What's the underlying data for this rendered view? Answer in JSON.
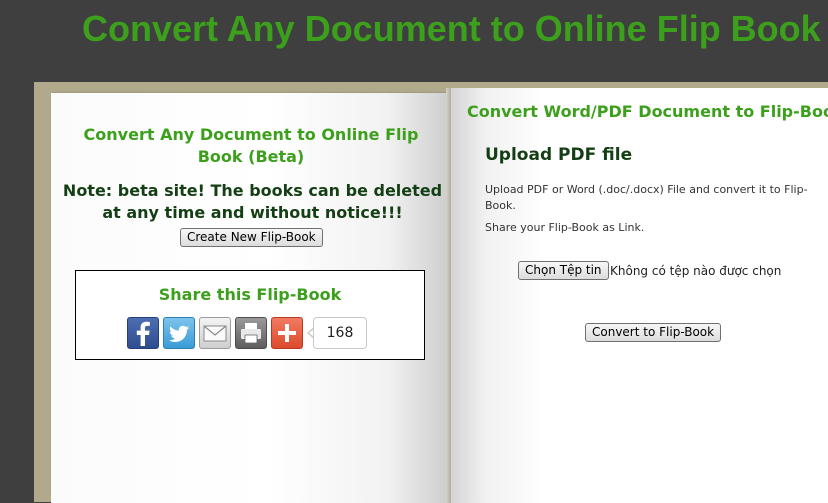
{
  "header": {
    "title": "Convert Any Document to Online Flip Book"
  },
  "left_page": {
    "title": "Convert Any Document to Online Flip Book (Beta)",
    "note": "Note: beta site! The books can be deleted at any time and without notice!!!",
    "create_button": "Create New Flip-Book",
    "share": {
      "title": "Share this Flip-Book",
      "icons": [
        "facebook-icon",
        "twitter-icon",
        "email-icon",
        "print-icon",
        "plus-icon"
      ],
      "count": "168"
    }
  },
  "right_page": {
    "title": "Convert Word/PDF Document to Flip-Book",
    "upload_title": "Upload PDF file",
    "description": "Upload PDF or Word (.doc/.docx) File and convert it to Flip-Book.",
    "description2": "Share your Flip-Book as Link.",
    "file_button": "Chọn Tệp tin",
    "file_status": "Không có tệp nào được chọn",
    "convert_button": "Convert to Flip-Book"
  },
  "colors": {
    "background": "#3f3f3f",
    "accent_green": "#3ca01c",
    "dark_green": "#143f14",
    "book_cover": "#b1a98c"
  }
}
